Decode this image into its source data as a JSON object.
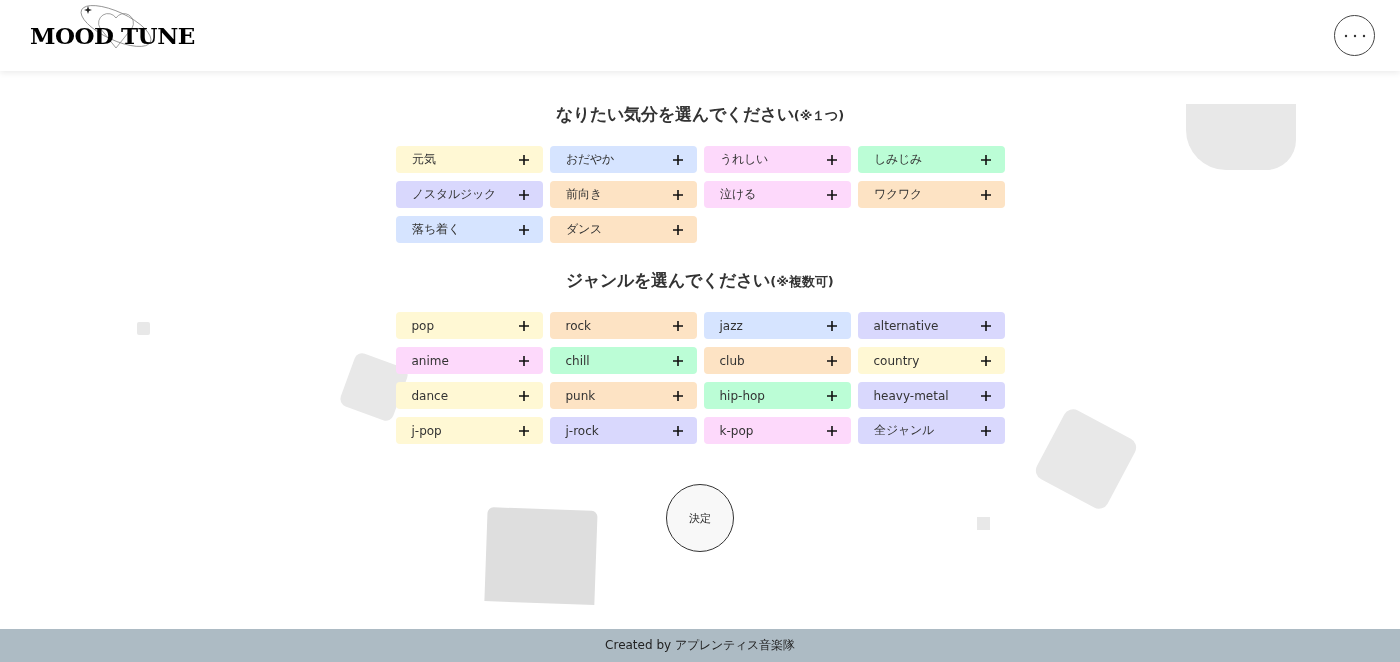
{
  "header": {
    "logo": "MOOD TUNE"
  },
  "sections": [
    {
      "title": "なりたい気分を選んでください",
      "note": "(※１つ)",
      "chips": [
        {
          "label": "元気",
          "color": "#fff8d4"
        },
        {
          "label": "おだやか",
          "color": "#d6e4ff"
        },
        {
          "label": "うれしい",
          "color": "#fdd9fb"
        },
        {
          "label": "しみじみ",
          "color": "#bbfdd6"
        },
        {
          "label": "ノスタルジック",
          "color": "#d9d8fd"
        },
        {
          "label": "前向き",
          "color": "#fde3c4"
        },
        {
          "label": "泣ける",
          "color": "#fdd9fb"
        },
        {
          "label": "ワクワク",
          "color": "#fde3c4"
        },
        {
          "label": "落ち着く",
          "color": "#d6e4ff"
        },
        {
          "label": "ダンス",
          "color": "#fde3c4"
        }
      ]
    },
    {
      "title": "ジャンルを選んでください",
      "note": "(※複数可)",
      "chips": [
        {
          "label": "pop",
          "color": "#fff8d4"
        },
        {
          "label": "rock",
          "color": "#fde3c4"
        },
        {
          "label": "jazz",
          "color": "#d6e4ff"
        },
        {
          "label": "alternative",
          "color": "#d9d8fd"
        },
        {
          "label": "anime",
          "color": "#fdd9fb"
        },
        {
          "label": "chill",
          "color": "#bbfdd6"
        },
        {
          "label": "club",
          "color": "#fde3c4"
        },
        {
          "label": "country",
          "color": "#fff8d4"
        },
        {
          "label": "dance",
          "color": "#fff8d4"
        },
        {
          "label": "punk",
          "color": "#fde3c4"
        },
        {
          "label": "hip-hop",
          "color": "#bbfdd6"
        },
        {
          "label": "heavy-metal",
          "color": "#d9d8fd"
        },
        {
          "label": "j-pop",
          "color": "#fff8d4"
        },
        {
          "label": "j-rock",
          "color": "#d9d8fd"
        },
        {
          "label": "k-pop",
          "color": "#fdd9fb"
        },
        {
          "label": "全ジャンル",
          "color": "#d9d8fd"
        }
      ]
    }
  ],
  "submit": {
    "label": "決定"
  },
  "footer": {
    "text": "Created by アプレンティス音楽隊"
  }
}
